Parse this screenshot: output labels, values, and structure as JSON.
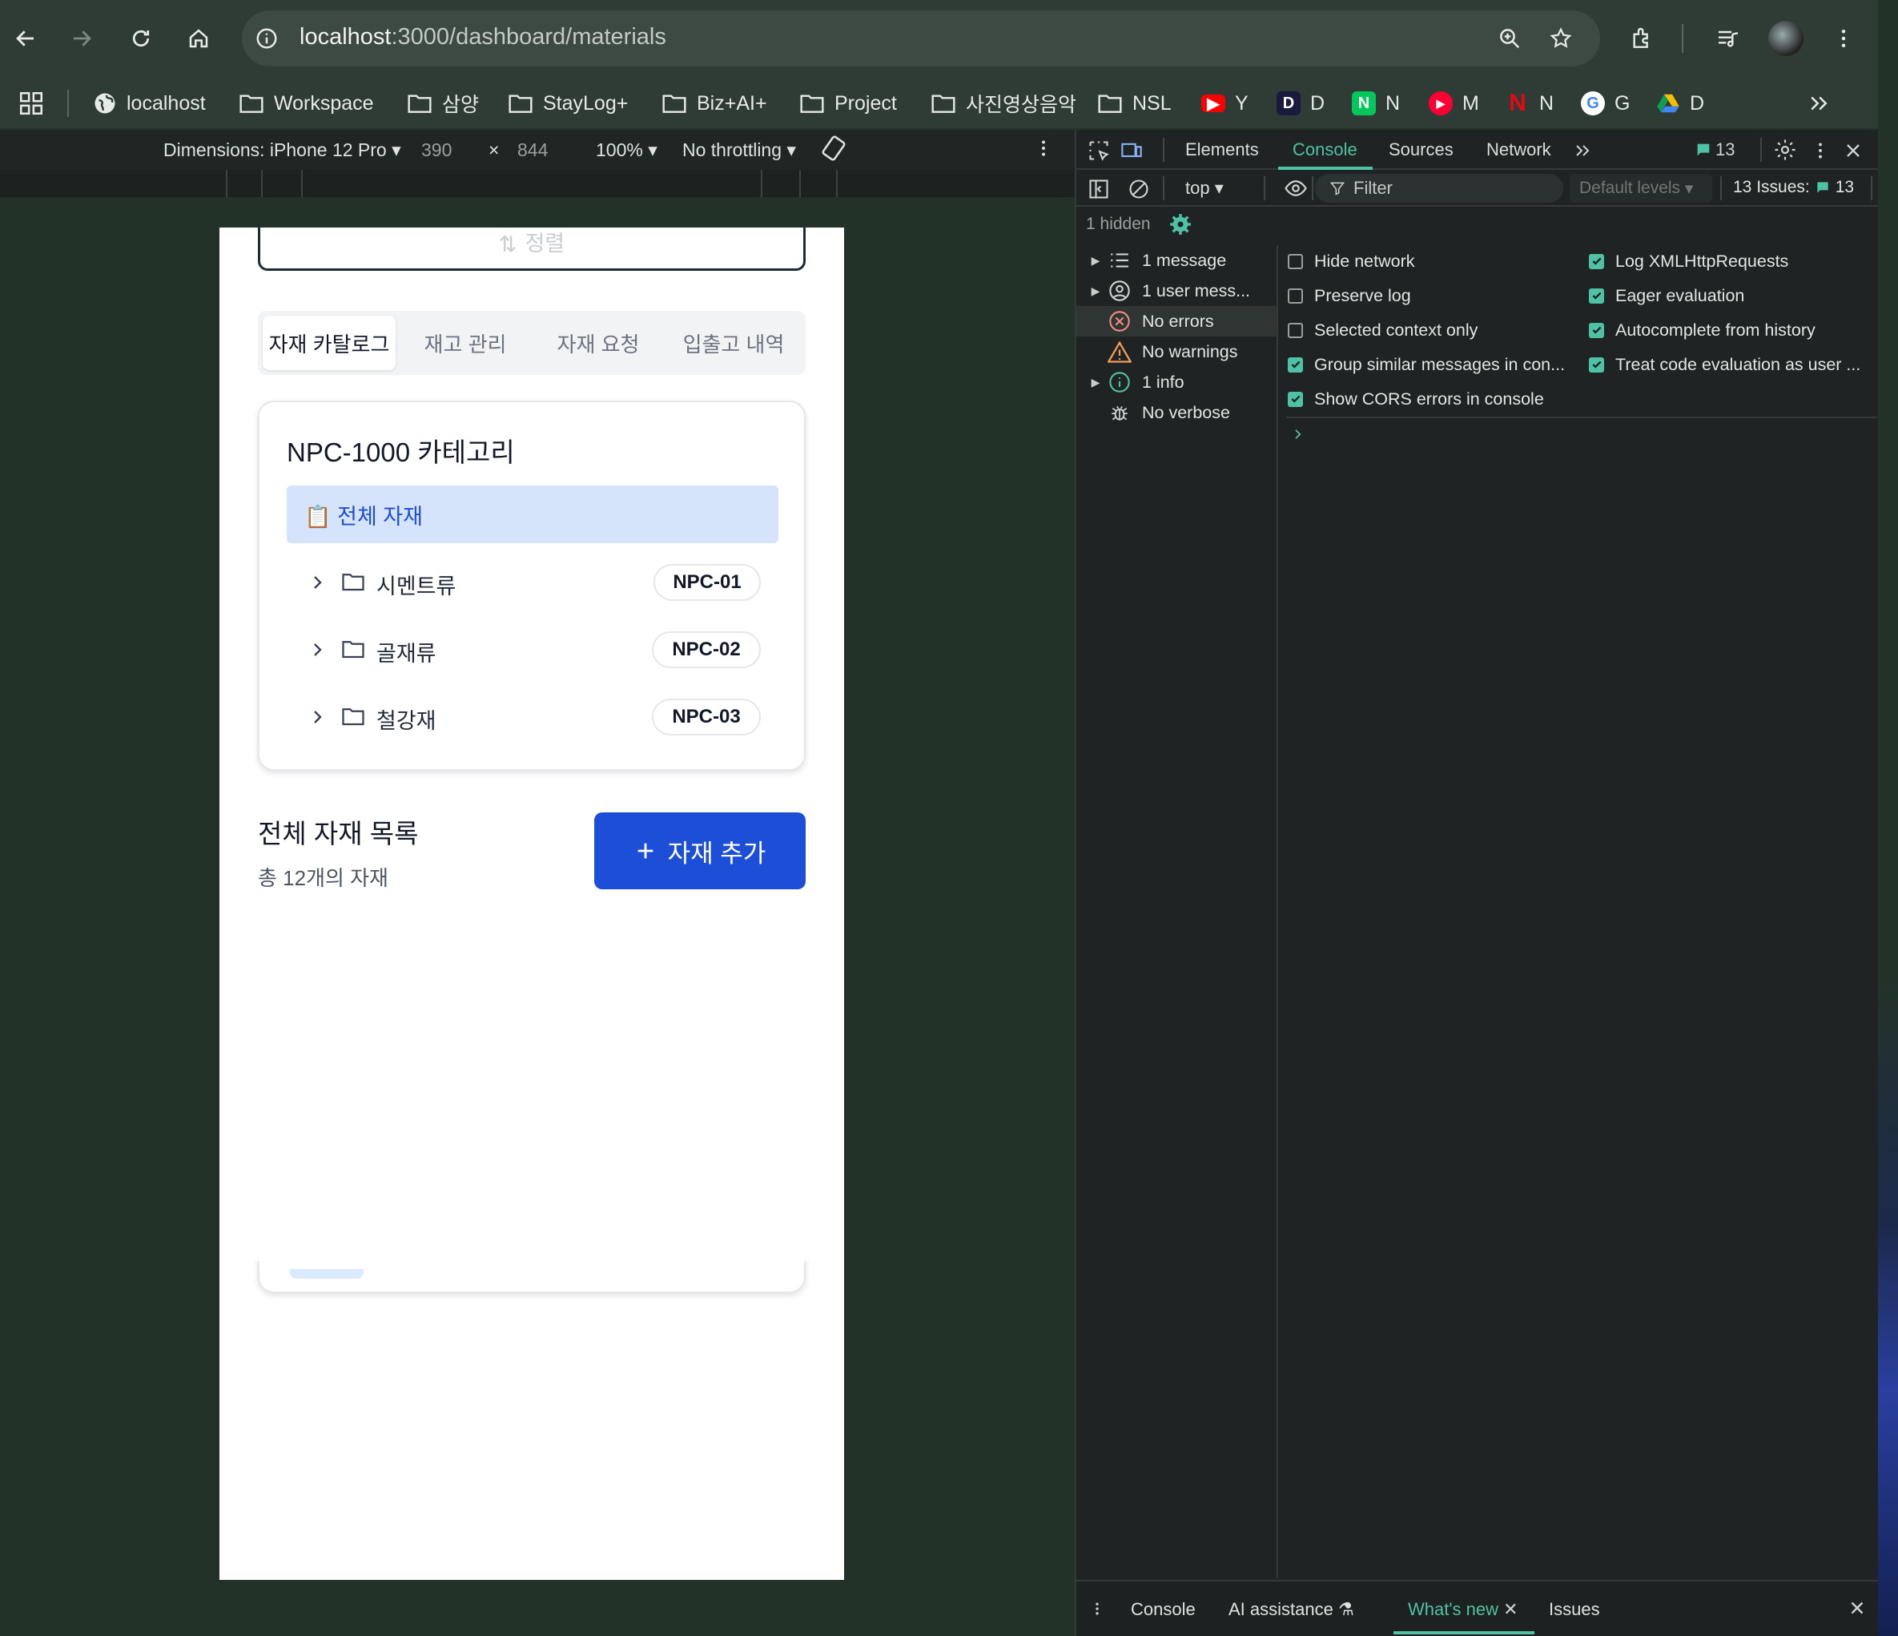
{
  "browser": {
    "url_host": "localhost",
    "url_path": ":3000/dashboard/materials",
    "bookmarks": [
      {
        "label": "localhost",
        "icon": "globe-icon"
      },
      {
        "label": "Workspace",
        "icon": "folder-icon"
      },
      {
        "label": "삼양",
        "icon": "folder-icon"
      },
      {
        "label": "StayLog+",
        "icon": "folder-icon"
      },
      {
        "label": "Biz+AI+",
        "icon": "folder-icon"
      },
      {
        "label": "Project",
        "icon": "folder-icon"
      },
      {
        "label": "사진영상음악",
        "icon": "folder-icon"
      },
      {
        "label": "NSL",
        "icon": "folder-icon"
      },
      {
        "label": "Y",
        "icon": "youtube-icon"
      },
      {
        "label": "D",
        "icon": "d-app-icon"
      },
      {
        "label": "N",
        "icon": "naver-icon"
      },
      {
        "label": "M",
        "icon": "music-icon"
      },
      {
        "label": "N",
        "icon": "netflix-icon"
      },
      {
        "label": "G",
        "icon": "google-icon"
      },
      {
        "label": "D",
        "icon": "drive-icon"
      }
    ]
  },
  "device_toolbar": {
    "dimensions_label": "Dimensions: iPhone 12 Pro",
    "width": "390",
    "x_sep": "×",
    "height": "844",
    "zoom": "100%",
    "throttle": "No throttling"
  },
  "app": {
    "sort_label": "정렬",
    "tabs": [
      "자재 카탈로그",
      "재고 관리",
      "자재 요청",
      "입출고 내역"
    ],
    "category_card": {
      "title": "NPC-1000 카테고리",
      "all_label": "📋 전체 자재",
      "items": [
        {
          "name": "시멘트류",
          "code": "NPC-01"
        },
        {
          "name": "골재류",
          "code": "NPC-02"
        },
        {
          "name": "철강재",
          "code": "NPC-03"
        }
      ]
    },
    "list_title": "전체 자재 목록",
    "list_count": "총 12개의 자재",
    "add_button": "자재 추가"
  },
  "devtools": {
    "tabs": [
      "Elements",
      "Console",
      "Sources",
      "Network"
    ],
    "issues_badge": "13",
    "context": "top",
    "filter_placeholder": "Filter",
    "levels": "Default levels",
    "issues_label": "13 Issues:",
    "issues_count": "13",
    "hidden": "1 hidden",
    "sidebar": [
      {
        "label": "1 message",
        "icon": "list-icon",
        "expandable": true
      },
      {
        "label": "1 user mess...",
        "icon": "user-icon",
        "expandable": true
      },
      {
        "label": "No errors",
        "icon": "error-icon",
        "expandable": false
      },
      {
        "label": "No warnings",
        "icon": "warning-icon",
        "expandable": false
      },
      {
        "label": "1 info",
        "icon": "info-icon",
        "expandable": true
      },
      {
        "label": "No verbose",
        "icon": "bug-icon",
        "expandable": false
      }
    ],
    "settings_left": [
      {
        "label": "Hide network",
        "checked": false
      },
      {
        "label": "Preserve log",
        "checked": false
      },
      {
        "label": "Selected context only",
        "checked": false
      },
      {
        "label": "Group similar messages in con...",
        "checked": true
      },
      {
        "label": "Show CORS errors in console",
        "checked": true
      }
    ],
    "settings_right": [
      {
        "label": "Log XMLHttpRequests",
        "checked": true
      },
      {
        "label": "Eager evaluation",
        "checked": true
      },
      {
        "label": "Autocomplete from history",
        "checked": true
      },
      {
        "label": "Treat code evaluation as user ...",
        "checked": true
      }
    ],
    "drawer_tabs": [
      "Console",
      "AI assistance",
      "What's new",
      "Issues"
    ]
  },
  "colors": {
    "accent": "#1d4ed8",
    "selected_bg": "#d6e4fb",
    "devtools_accent": "#4fc1a4"
  }
}
